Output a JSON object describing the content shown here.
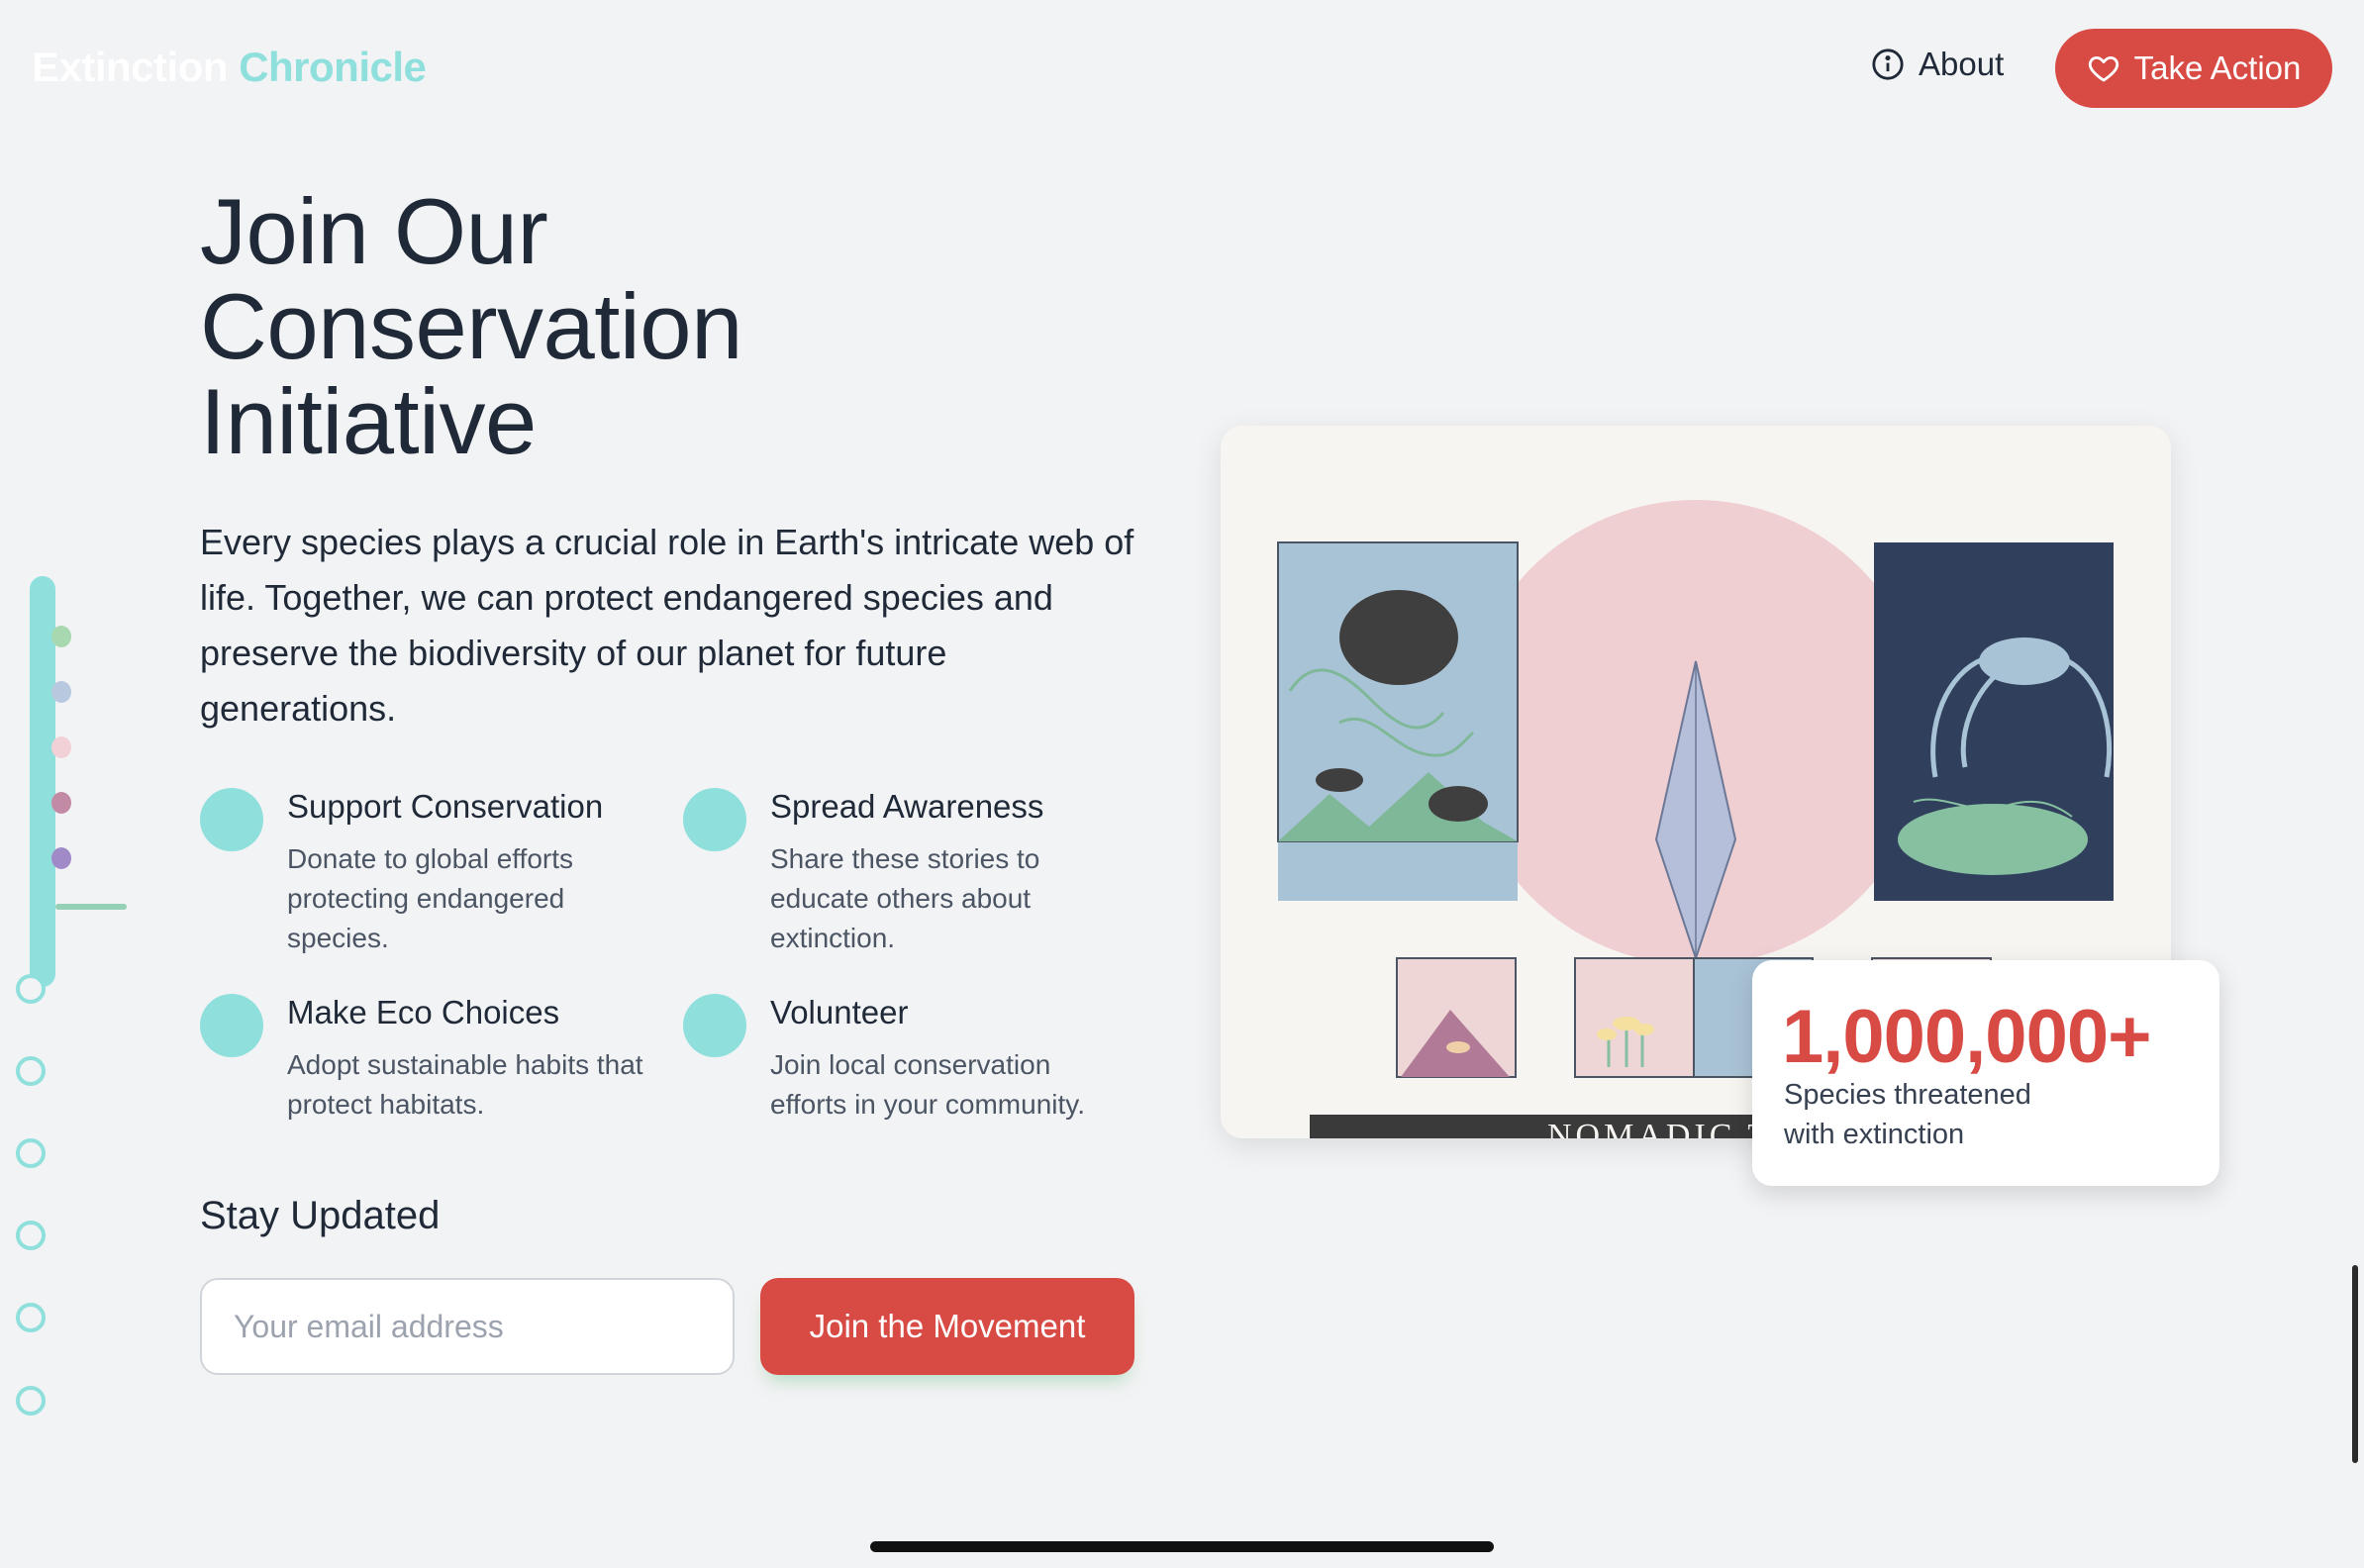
{
  "header": {
    "logo_part1": "Extinction",
    "logo_part2": "Chronicle",
    "about_label": "About",
    "take_action_label": "Take Action"
  },
  "hero": {
    "title_line1": "Join Our",
    "title_line2": "Conservation",
    "title_line3": "Initiative",
    "description": "Every species plays a crucial role in Earth's intricate web of life. Together, we can protect endangered species and preserve the biodiversity of our planet for future generations."
  },
  "features": [
    {
      "title": "Support Conservation",
      "text": "Donate to global efforts protecting endangered species."
    },
    {
      "title": "Spread Awareness",
      "text": "Share these stories to educate others about extinction."
    },
    {
      "title": "Make Eco Choices",
      "text": "Adopt sustainable habits that protect habitats."
    },
    {
      "title": "Volunteer",
      "text": "Join local conservation efforts in your community."
    }
  ],
  "newsletter": {
    "heading": "Stay Updated",
    "email_placeholder": "Your email address",
    "email_value": "",
    "button_label": "Join the Movement"
  },
  "artwork": {
    "caption_fragment": "NOMADIC T"
  },
  "stat": {
    "number": "1,000,000+",
    "label": "Species threatened with extinction"
  },
  "colors": {
    "accent": "#8fe0dc",
    "brand_red": "#d84b45",
    "text_dark": "#1f2937",
    "background": "#f2f3f5"
  },
  "icons": {
    "about": "info-icon",
    "take_action": "heart-icon"
  }
}
